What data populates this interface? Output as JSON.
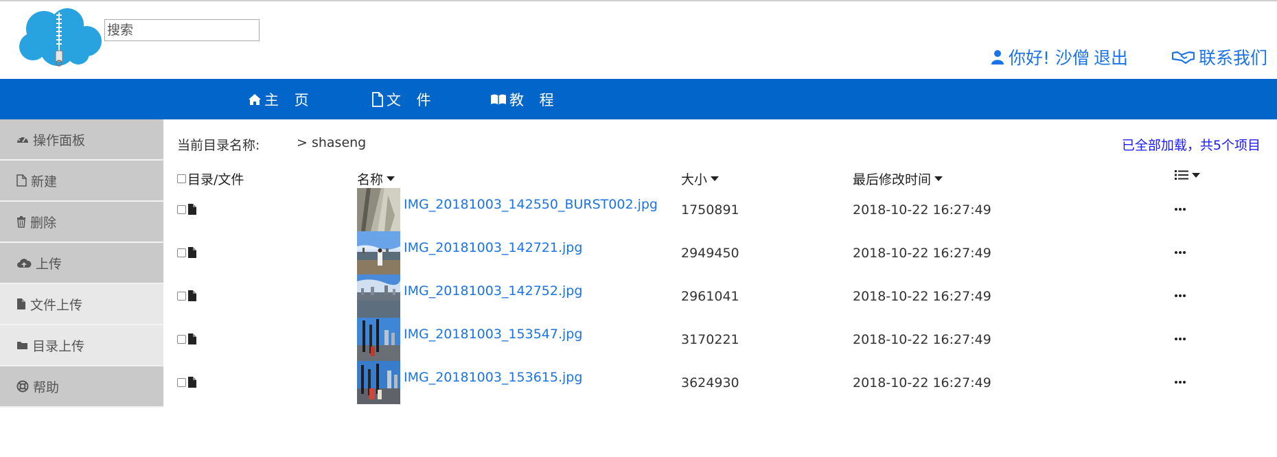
{
  "header": {
    "search_placeholder": "搜索",
    "user_greeting": "你好! 沙僧",
    "logout_label": "退出",
    "contact_label": "联系我们"
  },
  "nav": {
    "home": "主 页",
    "files": "文 件",
    "tutorial": "教 程"
  },
  "sidebar": {
    "items": [
      {
        "label": "操作面板",
        "icon": "dashboard-icon"
      },
      {
        "label": "新建",
        "icon": "file-new-icon"
      },
      {
        "label": "删除",
        "icon": "trash-icon"
      },
      {
        "label": "上传",
        "icon": "cloud-upload-icon"
      },
      {
        "label": "文件上传",
        "icon": "file-icon"
      },
      {
        "label": "目录上传",
        "icon": "folder-icon"
      },
      {
        "label": "帮助",
        "icon": "lifebuoy-icon"
      }
    ]
  },
  "breadcrumb": {
    "label": "当前目录名称:",
    "path": "> shaseng"
  },
  "status": {
    "text": "已全部加载，共5个项目"
  },
  "table": {
    "headers": {
      "dir_file": "目录/文件",
      "name": "名称",
      "size": "大小",
      "mtime": "最后修改时间"
    },
    "rows": [
      {
        "name": "IMG_20181003_142550_BURST002.jpg",
        "size": "1750891",
        "mtime": "2018-10-22 16:27:49"
      },
      {
        "name": "IMG_20181003_142721.jpg",
        "size": "2949450",
        "mtime": "2018-10-22 16:27:49"
      },
      {
        "name": "IMG_20181003_142752.jpg",
        "size": "2961041",
        "mtime": "2018-10-22 16:27:49"
      },
      {
        "name": "IMG_20181003_153547.jpg",
        "size": "3170221",
        "mtime": "2018-10-22 16:27:49"
      },
      {
        "name": "IMG_20181003_153615.jpg",
        "size": "3624930",
        "mtime": "2018-10-22 16:27:49"
      }
    ]
  },
  "colors": {
    "nav_background": "#0265c9",
    "link": "#1a73e8",
    "sidebar": "#c9c9c9",
    "sidebar_sub": "#e8e8e8",
    "status": "#1a1aff"
  }
}
